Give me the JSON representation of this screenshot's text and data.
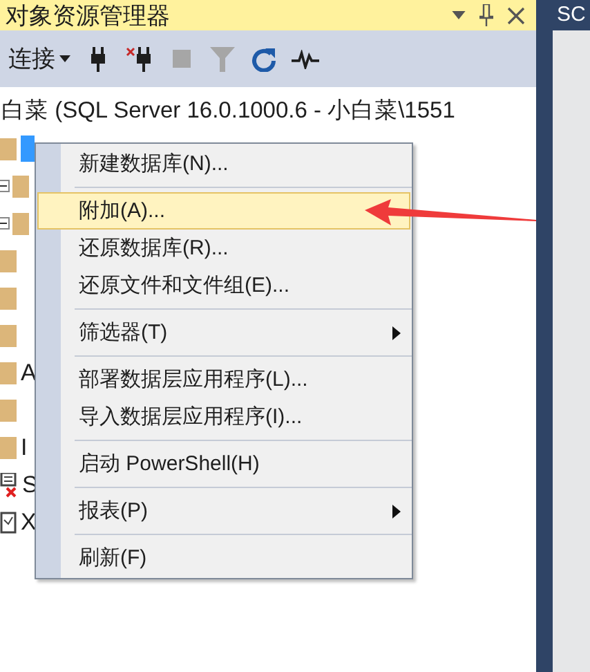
{
  "panel": {
    "title": "对象资源管理器"
  },
  "toolbar": {
    "connect_label": "连接",
    "buttons": [
      {
        "kind": "connect",
        "disabled": false
      },
      {
        "kind": "disconnect",
        "disabled": false
      },
      {
        "kind": "stop",
        "disabled": true
      },
      {
        "kind": "filter",
        "disabled": true
      },
      {
        "kind": "refresh",
        "disabled": false
      },
      {
        "kind": "activity",
        "disabled": false
      }
    ]
  },
  "tree": {
    "server": "白菜 (SQL Server 16.0.1000.6 - 小白菜\\1551",
    "items": [
      {
        "kind": "folder",
        "selected": true,
        "expandable": false
      },
      {
        "kind": "folder",
        "expandable": true,
        "selected": false
      },
      {
        "kind": "folder",
        "expandable": true,
        "selected": false
      },
      {
        "kind": "folder",
        "selected": false,
        "expandable": false
      },
      {
        "kind": "folder",
        "selected": false,
        "expandable": false
      },
      {
        "kind": "folder",
        "selected": false,
        "expandable": false
      },
      {
        "kind": "folder",
        "label": "A",
        "selected": false,
        "expandable": false
      },
      {
        "kind": "folder",
        "selected": false,
        "expandable": false
      },
      {
        "kind": "folder",
        "label": "I",
        "selected": false,
        "expandable": false
      },
      {
        "kind": "agent",
        "label": "S",
        "selected": false,
        "expandable": false
      },
      {
        "kind": "document",
        "label": "X",
        "selected": false,
        "expandable": false
      }
    ]
  },
  "context_menu": {
    "items": [
      {
        "kind": "item",
        "label": "新建数据库(N)...",
        "selected": false,
        "submenu": false
      },
      {
        "kind": "separator"
      },
      {
        "kind": "item",
        "label": "附加(A)...",
        "selected": true,
        "submenu": false
      },
      {
        "kind": "item",
        "label": "还原数据库(R)...",
        "selected": false,
        "submenu": false
      },
      {
        "kind": "item",
        "label": "还原文件和文件组(E)...",
        "selected": false,
        "submenu": false
      },
      {
        "kind": "separator"
      },
      {
        "kind": "item",
        "label": "筛选器(T)",
        "selected": false,
        "submenu": true
      },
      {
        "kind": "separator"
      },
      {
        "kind": "item",
        "label": "部署数据层应用程序(L)...",
        "selected": false,
        "submenu": false
      },
      {
        "kind": "item",
        "label": "导入数据层应用程序(I)...",
        "selected": false,
        "submenu": false
      },
      {
        "kind": "separator"
      },
      {
        "kind": "item",
        "label": "启动 PowerShell(H)",
        "selected": false,
        "submenu": false
      },
      {
        "kind": "separator"
      },
      {
        "kind": "item",
        "label": "报表(P)",
        "selected": false,
        "submenu": true
      },
      {
        "kind": "separator"
      },
      {
        "kind": "item",
        "label": "刷新(F)",
        "selected": false,
        "submenu": false
      }
    ]
  },
  "side_tab": {
    "label": "SC"
  }
}
